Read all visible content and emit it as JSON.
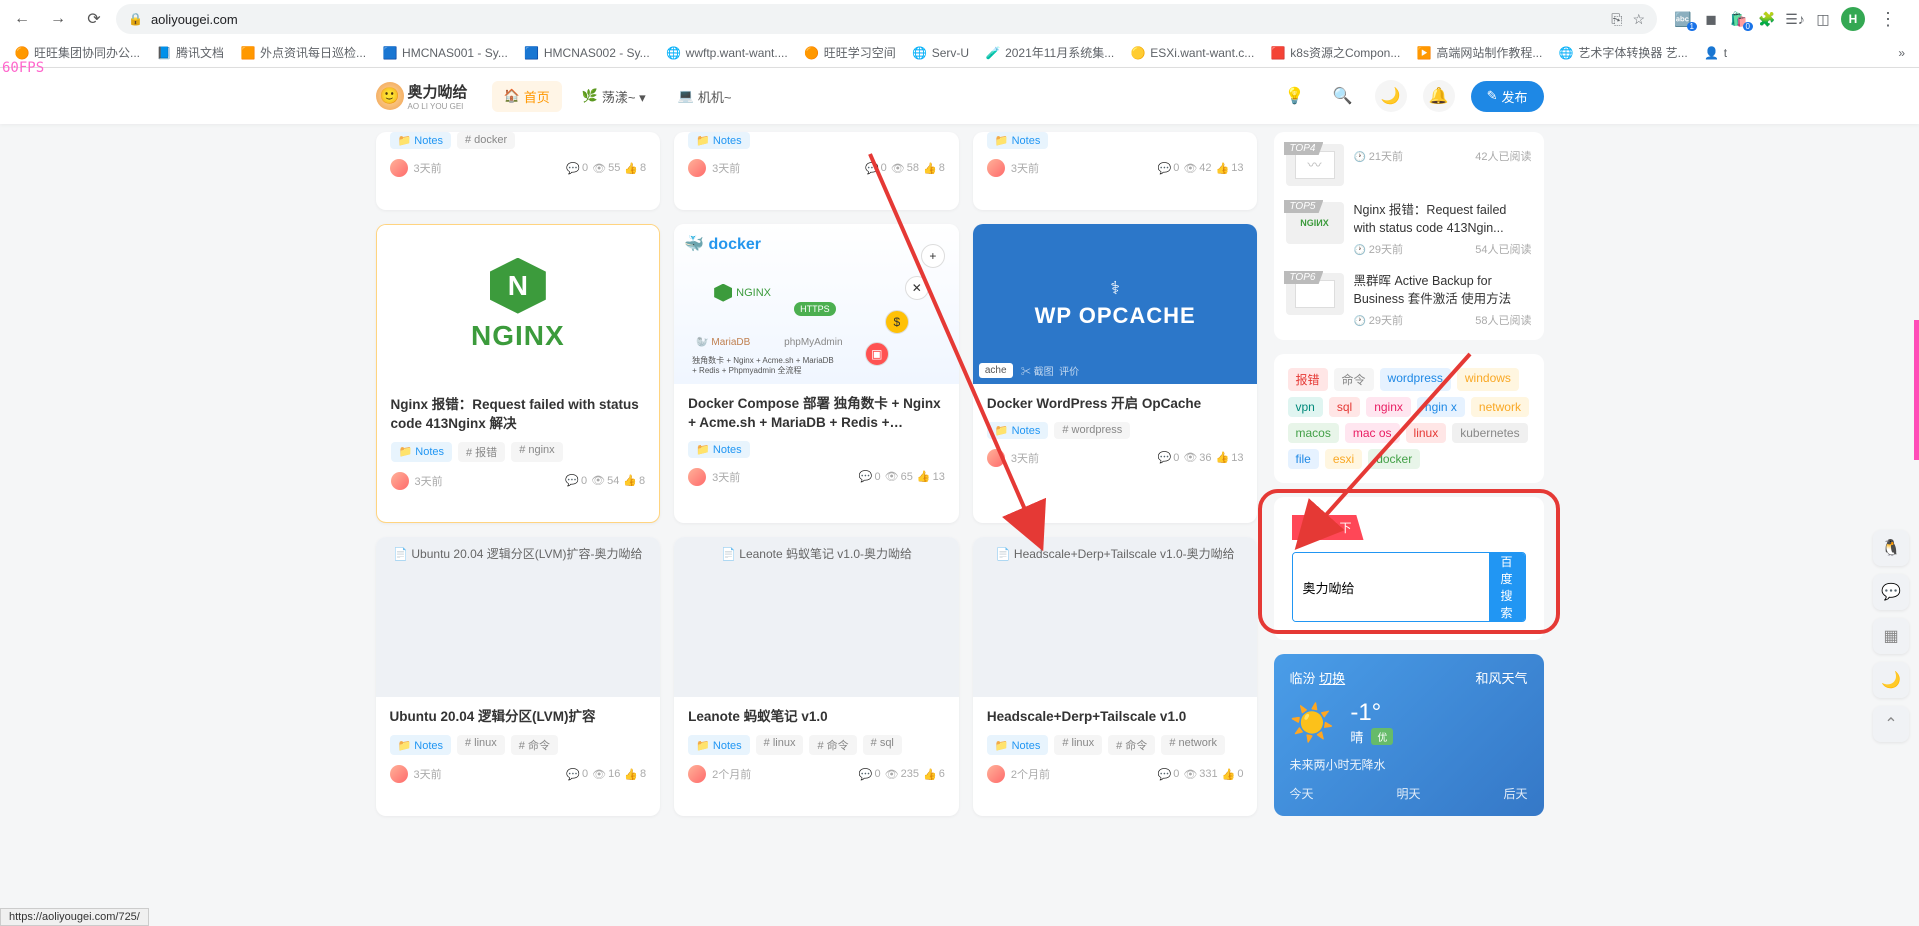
{
  "browser": {
    "url": "aoliyougei.com",
    "profile_letter": "H",
    "status_url": "https://aoliyougei.com/725/"
  },
  "bookmarks": [
    {
      "icon": "🟠",
      "label": "旺旺集团协同办公..."
    },
    {
      "icon": "📘",
      "label": "腾讯文档"
    },
    {
      "icon": "🟧",
      "label": "外点资讯每日巡检..."
    },
    {
      "icon": "🟦",
      "label": "HMCNAS001 - Sy..."
    },
    {
      "icon": "🟦",
      "label": "HMCNAS002 - Sy..."
    },
    {
      "icon": "🌐",
      "label": "wwftp.want-want...."
    },
    {
      "icon": "🟠",
      "label": "旺旺学习空间"
    },
    {
      "icon": "🌐",
      "label": "Serv-U"
    },
    {
      "icon": "🧪",
      "label": "2021年11月系统集..."
    },
    {
      "icon": "🟡",
      "label": "ESXi.want-want.c..."
    },
    {
      "icon": "🟥",
      "label": "k8s资源之Compon..."
    },
    {
      "icon": "▶️",
      "label": "高端网站制作教程..."
    },
    {
      "icon": "🌐",
      "label": "艺术字体转换器 艺..."
    },
    {
      "icon": "👤",
      "label": "t"
    }
  ],
  "fps": "60FPS",
  "site": {
    "logo_text": "奥力呦给",
    "logo_sub": "AO LI YOU GEI",
    "nav": [
      {
        "icon": "🏠",
        "label": "首页",
        "active": true
      },
      {
        "icon": "🌿",
        "label": "荡漾~ ▾"
      },
      {
        "icon": "💻",
        "label": "机机~"
      }
    ],
    "publish": "发布"
  },
  "top_row": [
    {
      "notes": "Notes",
      "tags": [
        "# docker"
      ],
      "time": "3天前",
      "comments": "0",
      "views": "55",
      "likes": "8"
    },
    {
      "notes": "Notes",
      "tags": [],
      "time": "3天前",
      "comments": "0",
      "views": "58",
      "likes": "8"
    },
    {
      "notes": "Notes",
      "tags": [],
      "time": "3天前",
      "comments": "0",
      "views": "42",
      "likes": "13"
    }
  ],
  "articles": [
    {
      "img": "nginx",
      "title": "Nginx 报错：Request failed with status code 413Nginx 解决",
      "notes": "Notes",
      "tags": [
        "# 报错",
        "# nginx"
      ],
      "time": "3天前",
      "comments": "0",
      "views": "54",
      "likes": "8",
      "highlighted": true
    },
    {
      "img": "docker",
      "title": "Docker Compose 部署 独角数卡 + Nginx + Acme.sh + MariaDB + Redis + Phpmyadmi...",
      "notes": "Notes",
      "tags": [],
      "time": "3天前",
      "comments": "0",
      "views": "65",
      "likes": "13"
    },
    {
      "img": "opcache",
      "title": "Docker WordPress 开启 OpCache",
      "notes": "Notes",
      "tags": [
        "# wordpress"
      ],
      "time": "3天前",
      "comments": "0",
      "views": "36",
      "likes": "13"
    },
    {
      "img": "alt",
      "alt": "Ubuntu 20.04 逻辑分区(LVM)扩容-奥力呦给",
      "title": "Ubuntu 20.04 逻辑分区(LVM)扩容",
      "notes": "Notes",
      "tags": [
        "# linux",
        "# 命令"
      ],
      "time": "3天前",
      "comments": "0",
      "views": "16",
      "likes": "8"
    },
    {
      "img": "alt",
      "alt": "Leanote 蚂蚁笔记 v1.0-奥力呦给",
      "title": "Leanote 蚂蚁笔记 v1.0",
      "notes": "Notes",
      "tags": [
        "# linux",
        "# 命令",
        "# sql"
      ],
      "time": "2个月前",
      "comments": "0",
      "views": "235",
      "likes": "6"
    },
    {
      "img": "alt",
      "alt": "Headscale+Derp+Tailscale v1.0-奥力呦给",
      "title": "Headscale+Derp+Tailscale v1.0",
      "notes": "Notes",
      "tags": [
        "# linux",
        "# 命令",
        "# network"
      ],
      "time": "2个月前",
      "comments": "0",
      "views": "331",
      "likes": "0"
    }
  ],
  "ranking": [
    {
      "rank": "TOP4",
      "thumb": "chart",
      "title": "",
      "time": "21天前",
      "reads": "42人已阅读"
    },
    {
      "rank": "TOP5",
      "thumb": "nginx",
      "title": "Nginx 报错：Request failed with status code 413Ngin...",
      "time": "29天前",
      "reads": "54人已阅读"
    },
    {
      "rank": "TOP6",
      "thumb": "synology",
      "title": "黑群晖 Active Backup for Business 套件激活 使用方法",
      "time": "29天前",
      "reads": "58人已阅读"
    }
  ],
  "tags": [
    {
      "t": "报错",
      "c": "#e53935",
      "bg": "#ffe6e6"
    },
    {
      "t": "命令",
      "c": "#888",
      "bg": "#f5f5f5"
    },
    {
      "t": "wordpress",
      "c": "#1e88e5",
      "bg": "#e6f2ff"
    },
    {
      "t": "windows",
      "c": "#f9a825",
      "bg": "#fff6e0"
    },
    {
      "t": "vpn",
      "c": "#00897b",
      "bg": "#e0f5f1"
    },
    {
      "t": "sql",
      "c": "#e53935",
      "bg": "#ffe6e6"
    },
    {
      "t": "nginx",
      "c": "#e91e63",
      "bg": "#ffe6f0"
    },
    {
      "t": "ngin x",
      "c": "#1e88e5",
      "bg": "#e6f2ff"
    },
    {
      "t": "network",
      "c": "#f9a825",
      "bg": "#fff6e0"
    },
    {
      "t": "macos",
      "c": "#43a047",
      "bg": "#e8f5e9"
    },
    {
      "t": "mac os",
      "c": "#e91e63",
      "bg": "#ffe6f0"
    },
    {
      "t": "linux",
      "c": "#e53935",
      "bg": "#ffe6e6"
    },
    {
      "t": "kubernetes",
      "c": "#888",
      "bg": "#f0f0f0"
    },
    {
      "t": "file",
      "c": "#1e88e5",
      "bg": "#e6f2ff"
    },
    {
      "t": "esxi",
      "c": "#f9a825",
      "bg": "#fff6e0"
    },
    {
      "t": "docker",
      "c": "#43a047",
      "bg": "#e8f5e9"
    }
  ],
  "search": {
    "tab": "百度一下",
    "value": "奥力呦给",
    "button": "百度搜索"
  },
  "weather": {
    "city": "临汾",
    "switch": "切换",
    "brand": "和风天气",
    "temp": "-1°",
    "cond": "晴",
    "quality": "优",
    "desc": "未来两小时无降水",
    "days": [
      "今天",
      "明天",
      "后天"
    ]
  },
  "docker_labels": {
    "brand": "docker",
    "nginx": "NGINX",
    "https": "HTTPS",
    "maria": "MariaDB",
    "phpmy": "phpMyAdmin",
    "sub1": "独角数卡 + Nginx + Acme.sh + MariaDB",
    "sub2": "+ Redis + Phpmyadmin 全流程"
  },
  "opcache_labels": {
    "brand": "WP OPCACHE",
    "ache": "ache",
    "cut": "截图",
    "review": "评价"
  },
  "nginx_label": "NGINX"
}
